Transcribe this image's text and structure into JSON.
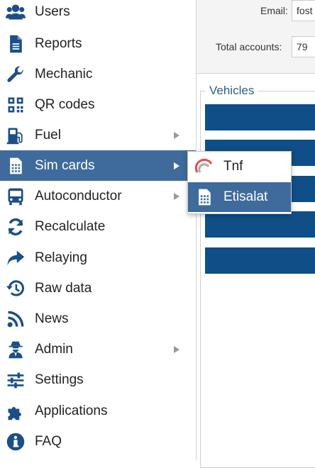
{
  "sidebar": {
    "items": [
      {
        "label": "Users",
        "icon": "users-icon",
        "has_submenu": false
      },
      {
        "label": "Reports",
        "icon": "file-icon",
        "has_submenu": false
      },
      {
        "label": "Mechanic",
        "icon": "wrench-icon",
        "has_submenu": false
      },
      {
        "label": "QR codes",
        "icon": "qrcode-icon",
        "has_submenu": false
      },
      {
        "label": "Fuel",
        "icon": "gas-pump-icon",
        "has_submenu": true
      },
      {
        "label": "Sim cards",
        "icon": "sim-card-icon",
        "has_submenu": true,
        "active": true
      },
      {
        "label": "Autoconductor",
        "icon": "bus-icon",
        "has_submenu": true
      },
      {
        "label": "Recalculate",
        "icon": "sync-icon",
        "has_submenu": false
      },
      {
        "label": "Relaying",
        "icon": "share-icon",
        "has_submenu": false
      },
      {
        "label": "Raw data",
        "icon": "history-icon",
        "has_submenu": false
      },
      {
        "label": "News",
        "icon": "rss-icon",
        "has_submenu": false
      },
      {
        "label": "Admin",
        "icon": "user-secret-icon",
        "has_submenu": true
      },
      {
        "label": "Settings",
        "icon": "sliders-icon",
        "has_submenu": false
      },
      {
        "label": "Applications",
        "icon": "puzzle-icon",
        "has_submenu": false
      },
      {
        "label": "FAQ",
        "icon": "info-circle-icon",
        "has_submenu": false
      }
    ]
  },
  "submenu": {
    "items": [
      {
        "label": "Tnf",
        "icon": "tnf-logo-icon"
      },
      {
        "label": "Etisalat",
        "icon": "sim-card-icon",
        "active": true
      }
    ]
  },
  "account": {
    "email_label": "Email:",
    "email_value": "fost",
    "total_accounts_label": "Total accounts:",
    "total_accounts_value": "79"
  },
  "vehicles": {
    "legend": "Vehicles"
  },
  "colors": {
    "accent": "#3e6b9c",
    "icon": "#1b4f86",
    "vehicle_bar": "#0f4e86"
  }
}
